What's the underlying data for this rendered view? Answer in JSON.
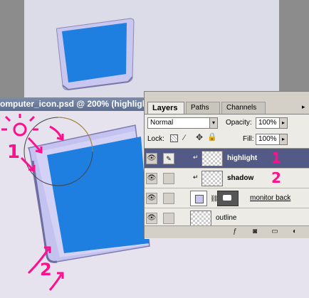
{
  "document": {
    "title": "omputer_icon.psd @ 200% (highligh"
  },
  "layers_panel": {
    "tabs": [
      {
        "label": "Layers",
        "active": true
      },
      {
        "label": "Paths",
        "active": false
      },
      {
        "label": "Channels",
        "active": false
      }
    ],
    "blend_mode": "Normal",
    "opacity_label": "Opacity:",
    "opacity_value": "100%",
    "lock_label": "Lock:",
    "fill_label": "Fill:",
    "fill_value": "100%",
    "layers": [
      {
        "name": "highlight",
        "visible": true,
        "selected": true,
        "clipped": true,
        "annotation": "1"
      },
      {
        "name": "shadow",
        "visible": true,
        "selected": false,
        "clipped": true,
        "annotation": "2"
      },
      {
        "name": "monitor back",
        "visible": true,
        "selected": false,
        "has_mask": true
      },
      {
        "name": "outline",
        "visible": true,
        "selected": false
      }
    ],
    "bottom_icons": [
      "layer-style-icon",
      "add-mask-icon",
      "new-set-icon",
      "adjustment-layer-icon"
    ]
  },
  "annotations": {
    "label_1": "1",
    "label_2": "2"
  },
  "colors": {
    "screen_blue": "#1e7fe0",
    "bezel": "#c9c7f0",
    "annotation_pink": "#ff0f8e",
    "selected_row": "#535a85",
    "title_bar": "#6b7a9c"
  }
}
